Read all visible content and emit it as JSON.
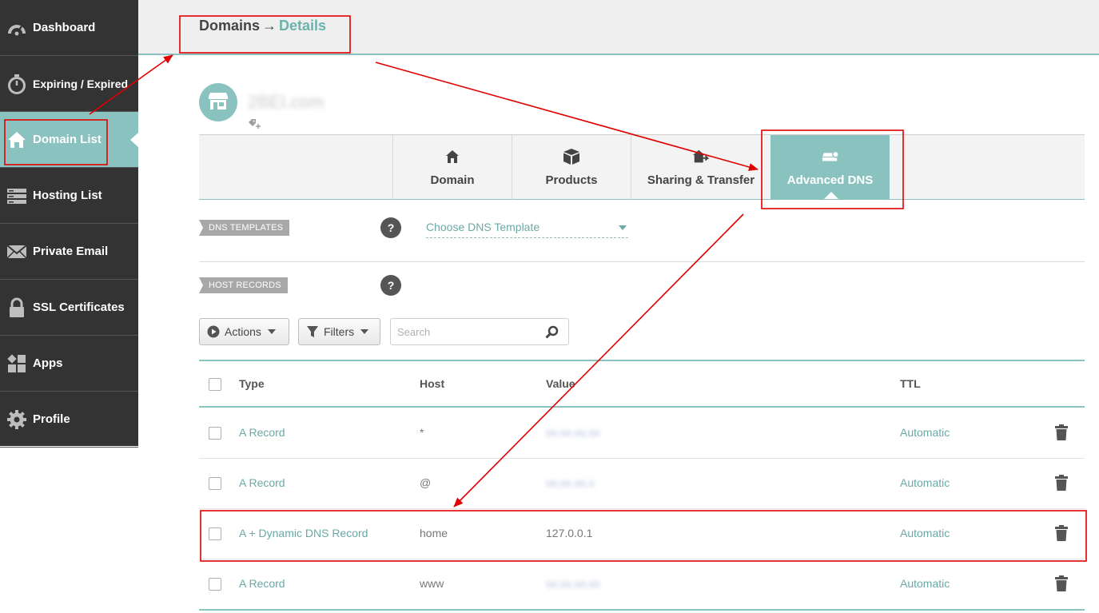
{
  "sidebar": {
    "items": [
      {
        "label": "Dashboard",
        "icon": "dashboard-icon",
        "active": false
      },
      {
        "label": "Expiring / Expired",
        "icon": "stopwatch-icon",
        "active": false
      },
      {
        "label": "Domain List",
        "icon": "home-icon",
        "active": true
      },
      {
        "label": "Hosting List",
        "icon": "server-icon",
        "active": false
      },
      {
        "label": "Private Email",
        "icon": "envelope-icon",
        "active": false
      },
      {
        "label": "SSL Certificates",
        "icon": "lock-icon",
        "active": false
      },
      {
        "label": "Apps",
        "icon": "apps-icon",
        "active": false
      },
      {
        "label": "Profile",
        "icon": "gear-icon",
        "active": false
      }
    ]
  },
  "header": {
    "breadcrumb_root": "Domains",
    "breadcrumb_separator": "→",
    "breadcrumb_current": "Details"
  },
  "domain": {
    "name": "2BEI.com",
    "avatar_icon": "storefront-icon",
    "tag_icon": "tag-add-icon"
  },
  "tabs": [
    {
      "label": "Domain",
      "icon": "house-icon",
      "active": false
    },
    {
      "label": "Products",
      "icon": "box-icon",
      "active": false
    },
    {
      "label": "Sharing & Transfer",
      "icon": "share-house-icon",
      "active": false
    },
    {
      "label": "Advanced DNS",
      "icon": "dns-server-icon",
      "active": true
    }
  ],
  "dns_templates": {
    "label": "DNS TEMPLATES",
    "help": "?",
    "select_value": "Choose DNS Template"
  },
  "host_records": {
    "label": "HOST RECORDS",
    "help": "?"
  },
  "toolbar": {
    "actions_label": "Actions",
    "filters_label": "Filters",
    "search_placeholder": "Search"
  },
  "table": {
    "columns": {
      "type": "Type",
      "host": "Host",
      "value": "Value",
      "ttl": "TTL"
    },
    "rows": [
      {
        "type": "A Record",
        "host": "*",
        "value": "xx.xx.xx.xx",
        "value_hidden": true,
        "ttl": "Automatic"
      },
      {
        "type": "A Record",
        "host": "@",
        "value": "xx.xx.xx.x",
        "value_hidden": true,
        "ttl": "Automatic"
      },
      {
        "type": "A + Dynamic DNS Record",
        "host": "home",
        "value": "127.0.0.1",
        "value_hidden": false,
        "ttl": "Automatic"
      },
      {
        "type": "A Record",
        "host": "www",
        "value": "xx.xx.xx.xx",
        "value_hidden": true,
        "ttl": "Automatic"
      }
    ]
  },
  "colors": {
    "accent": "#8ac2bf",
    "accent_text": "#6aa9a5",
    "sidebar_bg": "#333333",
    "annotation": "#e00000"
  }
}
